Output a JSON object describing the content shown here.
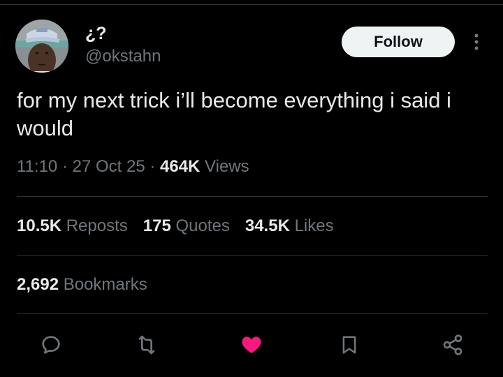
{
  "author": {
    "display_name": "¿?",
    "handle": "@okstahn"
  },
  "follow_label": "Follow",
  "tweet": {
    "text": "for my next trick i’ll become everything i said i would"
  },
  "meta": {
    "time": "11:10",
    "separator1": " · ",
    "date": "27 Oct 25",
    "separator2": " · ",
    "views_count": "464K",
    "views_label": " Views"
  },
  "stats": {
    "reposts_count": "10.5K",
    "reposts_label": " Reposts",
    "quotes_count": "175",
    "quotes_label": " Quotes",
    "likes_count": "34.5K",
    "likes_label": " Likes",
    "bookmarks_count": "2,692",
    "bookmarks_label": " Bookmarks"
  },
  "actions": [
    {
      "icon": "reply-icon"
    },
    {
      "icon": "repost-icon"
    },
    {
      "icon": "like-icon",
      "active": true
    },
    {
      "icon": "bookmark-icon"
    },
    {
      "icon": "share-icon"
    }
  ],
  "colors": {
    "background": "#000000",
    "text_primary": "#e7e9ea",
    "text_secondary": "#71767b",
    "like_active": "#f91880",
    "divider": "#2f3336",
    "follow_bg": "#eff3f4"
  }
}
